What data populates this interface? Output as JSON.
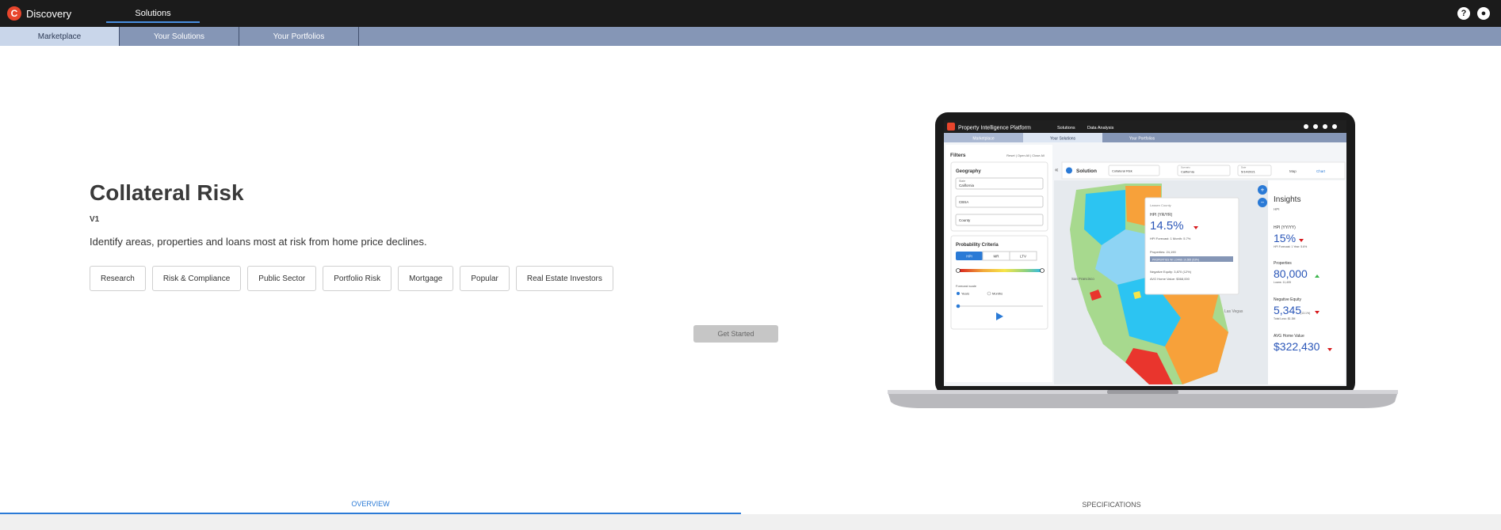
{
  "app": {
    "name": "Discovery",
    "logo_letter": "C"
  },
  "top_nav": {
    "active_tab": "Solutions"
  },
  "header_icons": {
    "help": "?",
    "user": "●"
  },
  "sub_nav": [
    "Marketplace",
    "Your Solutions",
    "Your Portfolios"
  ],
  "product": {
    "title": "Collateral Risk",
    "version": "V1",
    "description": "Identify areas, properties and loans most at risk from home price declines.",
    "tags": [
      "Research",
      "Risk & Compliance",
      "Public Sector",
      "Portfolio Risk",
      "Mortgage",
      "Popular",
      "Real Estate Investors"
    ],
    "cta": "Get Started"
  },
  "preview": {
    "app_title": "Property Intelligence Platform",
    "nav": [
      "Solutions",
      "Data Analysis"
    ],
    "tabs": [
      "Marketplace",
      "Your Solutions",
      "Your Portfolios"
    ],
    "filters_label": "Filters",
    "filter_actions": "Reset | Open All | Close All",
    "solution_label": "Solution",
    "solution_value": "Collateral Risk",
    "scenario_label": "Scenario",
    "scenario_value": "California",
    "date_label": "Date",
    "date_value": "5/14/2021",
    "view_map": "Map",
    "view_chart": "Chart",
    "geography_label": "Geography",
    "geo_fields": [
      {
        "label": "State",
        "value": "California"
      },
      {
        "label": "",
        "value": "CBSA"
      },
      {
        "label": "",
        "value": "County"
      }
    ],
    "probability_label": "Probability Criteria",
    "probability_tabs": [
      "HPI",
      "MR",
      "LTV"
    ],
    "forecast_scale_label": "Forecast scale",
    "forecast_options": [
      "Years",
      "Months"
    ],
    "popup": {
      "county": "Lassen County",
      "hpi_label": "HPI (YR/YR)",
      "hpi_value": "14.5%",
      "forecast": "HPI Forecast: 1 Month: 5.7%",
      "properties": "Properties: 24,190",
      "bar": "PROPERTIES W/ LOANS    10,555 (53%)",
      "neg_equity": "Negative Equity: 3,870 (12%)",
      "avg_home": "AVG Home Value: $368,000"
    },
    "insights": {
      "title": "Insights",
      "subtitle": "HPI",
      "items": [
        {
          "label": "HPI (YY/YY)",
          "value": "15%",
          "sub": "HPI Forecast: 1 Year: 5.6%"
        },
        {
          "label": "Properties",
          "value": "80,000",
          "sub": "Loans: 11,405"
        },
        {
          "label": "Negative Equity",
          "value": "5,345",
          "extra": "(13.1%)",
          "sub": "Total Loss: $1.3M"
        },
        {
          "label": "AVG Home Value",
          "value": "$322,430",
          "sub": ""
        }
      ]
    },
    "map_labels": [
      "San Francisco",
      "Las Vegas"
    ]
  },
  "bottom_tabs": [
    "OVERVIEW",
    "SPECIFICATIONS"
  ],
  "colors": {
    "accent": "#2a7ad6",
    "topbar": "#1b1b1b",
    "subnav": "#8596b6",
    "brand": "#e8452c"
  }
}
